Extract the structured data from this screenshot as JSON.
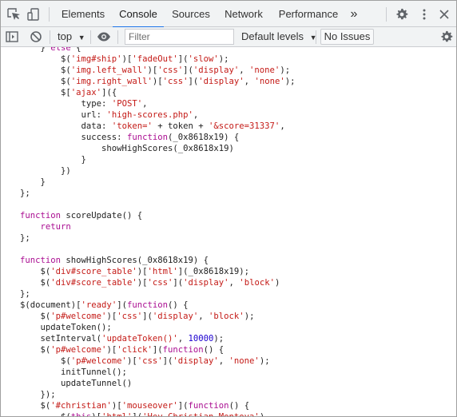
{
  "tabs": [
    {
      "label": "Elements",
      "name": "tab-elements",
      "active": false
    },
    {
      "label": "Console",
      "name": "tab-console",
      "active": true
    },
    {
      "label": "Sources",
      "name": "tab-sources",
      "active": false
    },
    {
      "label": "Network",
      "name": "tab-network",
      "active": false
    },
    {
      "label": "Performance",
      "name": "tab-performance",
      "active": false
    }
  ],
  "more_tabs": "»",
  "toolbar": {
    "context": "top",
    "filter_placeholder": "Filter",
    "levels": "Default levels",
    "no_issues": "No Issues"
  },
  "colors": {
    "keyword": "#aa0d91",
    "string": "#c41a16",
    "number": "#1c00cf",
    "accent": "#1a73e8"
  },
  "code_lines": [
    [
      [
        "p",
        "    } "
      ],
      [
        "k",
        "else"
      ],
      [
        "p",
        " {"
      ]
    ],
    [
      [
        "p",
        "        $("
      ],
      [
        "s",
        "'img#ship'"
      ],
      [
        "p",
        ")["
      ],
      [
        "s",
        "'fadeOut'"
      ],
      [
        "p",
        "]("
      ],
      [
        "s",
        "'slow'"
      ],
      [
        "p",
        ");"
      ]
    ],
    [
      [
        "p",
        "        $("
      ],
      [
        "s",
        "'img.left_wall'"
      ],
      [
        "p",
        ")["
      ],
      [
        "s",
        "'css'"
      ],
      [
        "p",
        "]("
      ],
      [
        "s",
        "'display'"
      ],
      [
        "p",
        ", "
      ],
      [
        "s",
        "'none'"
      ],
      [
        "p",
        ");"
      ]
    ],
    [
      [
        "p",
        "        $("
      ],
      [
        "s",
        "'img.right_wall'"
      ],
      [
        "p",
        ")["
      ],
      [
        "s",
        "'css'"
      ],
      [
        "p",
        "]("
      ],
      [
        "s",
        "'display'"
      ],
      [
        "p",
        ", "
      ],
      [
        "s",
        "'none'"
      ],
      [
        "p",
        ");"
      ]
    ],
    [
      [
        "p",
        "        $["
      ],
      [
        "s",
        "'ajax'"
      ],
      [
        "p",
        "]({"
      ]
    ],
    [
      [
        "p",
        "            type: "
      ],
      [
        "s",
        "'POST'"
      ],
      [
        "p",
        ","
      ]
    ],
    [
      [
        "p",
        "            url: "
      ],
      [
        "s",
        "'high-scores.php'"
      ],
      [
        "p",
        ","
      ]
    ],
    [
      [
        "p",
        "            data: "
      ],
      [
        "s",
        "'token='"
      ],
      [
        "p",
        " + token + "
      ],
      [
        "s",
        "'&score=31337'"
      ],
      [
        "p",
        ","
      ]
    ],
    [
      [
        "p",
        "            success: "
      ],
      [
        "k",
        "function"
      ],
      [
        "p",
        "(_0x8618x19) {"
      ]
    ],
    [
      [
        "p",
        "                showHighScores(_0x8618x19)"
      ]
    ],
    [
      [
        "p",
        "            }"
      ]
    ],
    [
      [
        "p",
        "        })"
      ]
    ],
    [
      [
        "p",
        "    }"
      ]
    ],
    [
      [
        "p",
        "};"
      ]
    ],
    [
      [
        "p",
        ""
      ]
    ],
    [
      [
        "k",
        "function"
      ],
      [
        "p",
        " scoreUpdate() {"
      ]
    ],
    [
      [
        "p",
        "    "
      ],
      [
        "k",
        "return"
      ]
    ],
    [
      [
        "p",
        "};"
      ]
    ],
    [
      [
        "p",
        ""
      ]
    ],
    [
      [
        "k",
        "function"
      ],
      [
        "p",
        " showHighScores(_0x8618x19) {"
      ]
    ],
    [
      [
        "p",
        "    $("
      ],
      [
        "s",
        "'div#score_table'"
      ],
      [
        "p",
        ")["
      ],
      [
        "s",
        "'html'"
      ],
      [
        "p",
        "](_0x8618x19);"
      ]
    ],
    [
      [
        "p",
        "    $("
      ],
      [
        "s",
        "'div#score_table'"
      ],
      [
        "p",
        ")["
      ],
      [
        "s",
        "'css'"
      ],
      [
        "p",
        "]("
      ],
      [
        "s",
        "'display'"
      ],
      [
        "p",
        ", "
      ],
      [
        "s",
        "'block'"
      ],
      [
        "p",
        ")"
      ]
    ],
    [
      [
        "p",
        "};"
      ]
    ],
    [
      [
        "p",
        "$(document)["
      ],
      [
        "s",
        "'ready'"
      ],
      [
        "p",
        "]("
      ],
      [
        "k",
        "function"
      ],
      [
        "p",
        "() {"
      ]
    ],
    [
      [
        "p",
        "    $("
      ],
      [
        "s",
        "'p#welcome'"
      ],
      [
        "p",
        ")["
      ],
      [
        "s",
        "'css'"
      ],
      [
        "p",
        "]("
      ],
      [
        "s",
        "'display'"
      ],
      [
        "p",
        ", "
      ],
      [
        "s",
        "'block'"
      ],
      [
        "p",
        ");"
      ]
    ],
    [
      [
        "p",
        "    updateToken();"
      ]
    ],
    [
      [
        "p",
        "    setInterval("
      ],
      [
        "s",
        "'updateToken()'"
      ],
      [
        "p",
        ", "
      ],
      [
        "n",
        "10000"
      ],
      [
        "p",
        ");"
      ]
    ],
    [
      [
        "p",
        "    $("
      ],
      [
        "s",
        "'p#welcome'"
      ],
      [
        "p",
        ")["
      ],
      [
        "s",
        "'click'"
      ],
      [
        "p",
        "]("
      ],
      [
        "k",
        "function"
      ],
      [
        "p",
        "() {"
      ]
    ],
    [
      [
        "p",
        "        $("
      ],
      [
        "s",
        "'p#welcome'"
      ],
      [
        "p",
        ")["
      ],
      [
        "s",
        "'css'"
      ],
      [
        "p",
        "]("
      ],
      [
        "s",
        "'display'"
      ],
      [
        "p",
        ", "
      ],
      [
        "s",
        "'none'"
      ],
      [
        "p",
        ");"
      ]
    ],
    [
      [
        "p",
        "        initTunnel();"
      ]
    ],
    [
      [
        "p",
        "        updateTunnel()"
      ]
    ],
    [
      [
        "p",
        "    });"
      ]
    ],
    [
      [
        "p",
        "    $("
      ],
      [
        "s",
        "'#christian'"
      ],
      [
        "p",
        ")["
      ],
      [
        "s",
        "'mouseover'"
      ],
      [
        "p",
        "]("
      ],
      [
        "k",
        "function"
      ],
      [
        "p",
        "() {"
      ]
    ],
    [
      [
        "p",
        "        $("
      ],
      [
        "k",
        "this"
      ],
      [
        "p",
        ")["
      ],
      [
        "s",
        "'html'"
      ],
      [
        "p",
        "]("
      ],
      [
        "s",
        "'Hey Christian Montoya'"
      ],
      [
        "p",
        ")"
      ]
    ]
  ]
}
